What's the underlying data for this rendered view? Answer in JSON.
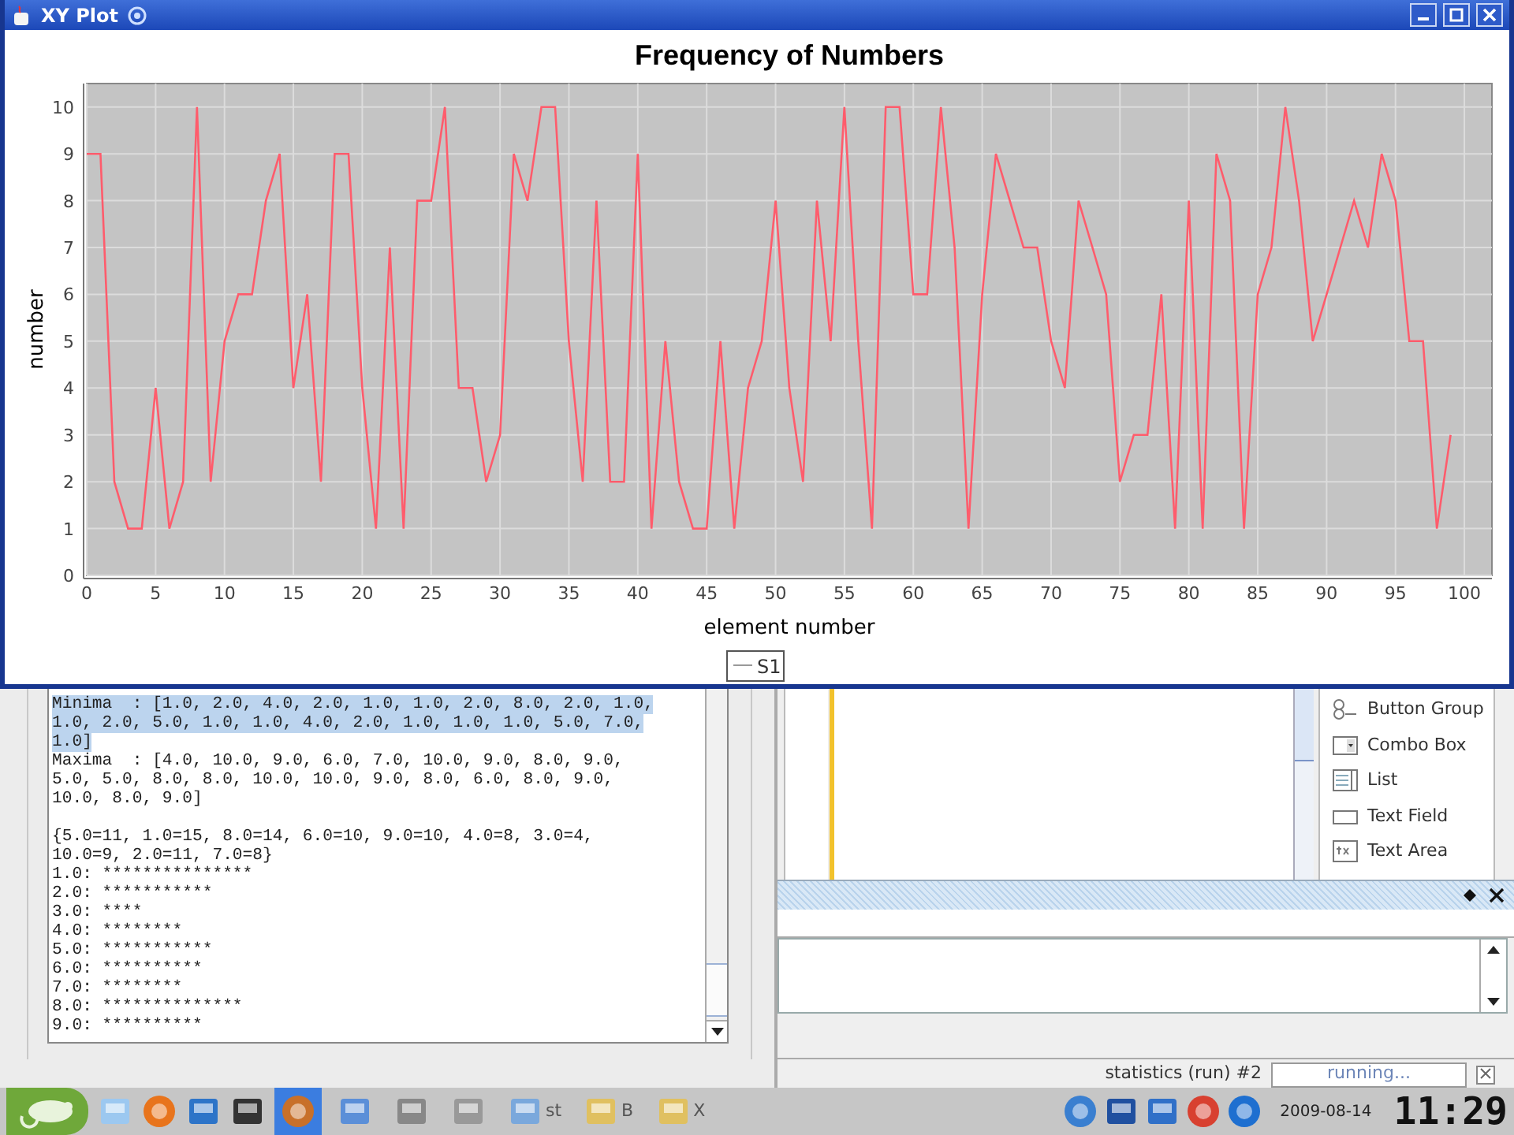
{
  "window": {
    "title": "XY Plot"
  },
  "chart": {
    "chart_data": {
      "type": "line",
      "grid": true,
      "title": "Frequency of Numbers",
      "xlabel": "element number",
      "ylabel": "number",
      "x": [
        0,
        1,
        2,
        3,
        4,
        5,
        6,
        7,
        8,
        9,
        10,
        11,
        12,
        13,
        14,
        15,
        16,
        17,
        18,
        19,
        20,
        21,
        22,
        23,
        24,
        25,
        26,
        27,
        28,
        29,
        30,
        31,
        32,
        33,
        34,
        35,
        36,
        37,
        38,
        39,
        40,
        41,
        42,
        43,
        44,
        45,
        46,
        47,
        48,
        49,
        50,
        51,
        52,
        53,
        54,
        55,
        56,
        57,
        58,
        59,
        60,
        61,
        62,
        63,
        64,
        65,
        66,
        67,
        68,
        69,
        70,
        71,
        72,
        73,
        74,
        75,
        76,
        77,
        78,
        79,
        80,
        81,
        82,
        83,
        84,
        85,
        86,
        87,
        88,
        89,
        90,
        91,
        92,
        93,
        94,
        95,
        96,
        97,
        98,
        99
      ],
      "series": [
        {
          "name": "S1",
          "color": "#ff5c6c",
          "values": [
            9,
            9,
            2,
            1,
            1,
            4,
            1,
            2,
            10,
            2,
            5,
            6,
            6,
            8,
            9,
            4,
            6,
            2,
            9,
            9,
            4,
            1,
            7,
            1,
            8,
            8,
            10,
            4,
            4,
            2,
            3,
            9,
            8,
            10,
            10,
            5,
            2,
            8,
            2,
            2,
            9,
            1,
            5,
            2,
            1,
            1,
            5,
            1,
            4,
            5,
            8,
            4,
            2,
            8,
            5,
            10,
            5,
            1,
            10,
            10,
            6,
            6,
            10,
            7,
            1,
            6,
            9,
            8,
            7,
            7,
            5,
            4,
            8,
            7,
            6,
            2,
            3,
            3,
            6,
            1,
            8,
            1,
            9,
            8,
            1,
            6,
            7,
            10,
            8,
            5,
            6,
            7,
            8,
            7,
            9,
            8,
            5,
            5,
            1,
            3
          ]
        }
      ],
      "xlim": [
        0,
        102
      ],
      "ylim": [
        0,
        10.5
      ],
      "xticks": [
        0,
        5,
        10,
        15,
        20,
        25,
        30,
        35,
        40,
        45,
        50,
        55,
        60,
        65,
        70,
        75,
        80,
        85,
        90,
        95,
        100
      ],
      "yticks": [
        0,
        1,
        2,
        3,
        4,
        5,
        6,
        7,
        8,
        9,
        10
      ]
    }
  },
  "output": {
    "blocks": [
      [
        {
          "text": "Minima  : [1.0, 2.0, 4.0, 2.0, 1.0, 1.0, 2.0, 8.0, 2.0, 1.0,",
          "selected": true
        },
        {
          "text": "1.0, 2.0, 5.0, 1.0, 1.0, 4.0, 2.0, 1.0, 1.0, 1.0, 5.0, 7.0,",
          "selected": true
        },
        {
          "text": "1.0]",
          "selected": true
        },
        {
          "text": "Maxima  : [4.0, 10.0, 9.0, 6.0, 7.0, 10.0, 9.0, 8.0, 9.0,",
          "selected": false
        },
        {
          "text": "5.0, 5.0, 8.0, 8.0, 10.0, 10.0, 9.0, 8.0, 6.0, 8.0, 9.0,",
          "selected": false
        },
        {
          "text": "10.0, 8.0, 9.0]",
          "selected": false
        }
      ],
      [
        {
          "text": "{5.0=11, 1.0=15, 8.0=14, 6.0=10, 9.0=10, 4.0=8, 3.0=4,",
          "selected": false
        },
        {
          "text": "10.0=9, 2.0=11, 7.0=8}",
          "selected": false
        },
        {
          "text": "1.0: ***************",
          "selected": false
        },
        {
          "text": "2.0: ***********",
          "selected": false
        },
        {
          "text": "3.0: ****",
          "selected": false
        },
        {
          "text": "4.0: ********",
          "selected": false
        },
        {
          "text": "5.0: ***********",
          "selected": false
        },
        {
          "text": "6.0: **********",
          "selected": false
        },
        {
          "text": "7.0: ********",
          "selected": false
        },
        {
          "text": "8.0: **************",
          "selected": false
        },
        {
          "text": "9.0: **********",
          "selected": false
        }
      ]
    ]
  },
  "palette": {
    "items": [
      {
        "label": "Button Group",
        "kind": "buttongroup"
      },
      {
        "label": "Combo Box",
        "kind": "combobox"
      },
      {
        "label": "List",
        "kind": "list"
      },
      {
        "label": "Text Field",
        "kind": "textfield"
      },
      {
        "label": "Text Area",
        "kind": "textarea"
      }
    ]
  },
  "status": {
    "task": "statistics (run) #2",
    "progress": "running..."
  },
  "taskbar": {
    "tasks": [
      {
        "label": "st",
        "selected": false
      },
      {
        "label": "B",
        "selected": false
      },
      {
        "label": "X",
        "selected": false
      }
    ],
    "date": "2009-08-14",
    "time": "11:29"
  }
}
